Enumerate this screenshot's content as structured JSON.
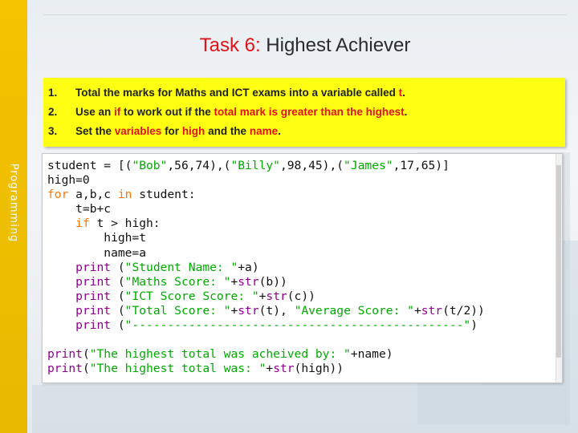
{
  "side_label": "Programming",
  "title": {
    "accent": "Task 6:",
    "rest": "Highest Achiever"
  },
  "tasks": [
    {
      "num": "1.",
      "parts": [
        {
          "text": "Total the marks for Maths and ICT exams into a variable called ",
          "color": "dark"
        },
        {
          "text": "t",
          "color": "red"
        },
        {
          "text": ".",
          "color": "dark"
        }
      ]
    },
    {
      "num": "2.",
      "parts": [
        {
          "text": "Use an ",
          "color": "dark"
        },
        {
          "text": "if",
          "color": "red"
        },
        {
          "text": " to work out if the ",
          "color": "dark"
        },
        {
          "text": "total mark is greater than the highest",
          "color": "red"
        },
        {
          "text": ".",
          "color": "dark"
        }
      ]
    },
    {
      "num": "3.",
      "parts": [
        {
          "text": "Set the ",
          "color": "dark"
        },
        {
          "text": "variables",
          "color": "red"
        },
        {
          "text": " for ",
          "color": "dark"
        },
        {
          "text": "high",
          "color": "red"
        },
        {
          "text": " and the ",
          "color": "dark"
        },
        {
          "text": "name",
          "color": "red"
        },
        {
          "text": ".",
          "color": "dark"
        }
      ]
    }
  ],
  "code": {
    "lines": [
      [
        [
          "student = [(",
          "n"
        ],
        [
          "\"Bob\"",
          "s"
        ],
        [
          ",56,74),(",
          "n"
        ],
        [
          "\"Billy\"",
          "s"
        ],
        [
          ",98,45),(",
          "n"
        ],
        [
          "\"James\"",
          "s"
        ],
        [
          ",17,65)]",
          "n"
        ]
      ],
      [
        [
          "high=0",
          "n"
        ]
      ],
      [
        [
          "for",
          "k"
        ],
        [
          " a,b,c ",
          "n"
        ],
        [
          "in",
          "k"
        ],
        [
          " student:",
          "n"
        ]
      ],
      [
        [
          "    t=b+c",
          "n"
        ]
      ],
      [
        [
          "    ",
          "n"
        ],
        [
          "if",
          "k"
        ],
        [
          " t > high:",
          "n"
        ]
      ],
      [
        [
          "        high=t",
          "n"
        ]
      ],
      [
        [
          "        name=a",
          "n"
        ]
      ],
      [
        [
          "    ",
          "n"
        ],
        [
          "print",
          "b"
        ],
        [
          " (",
          "n"
        ],
        [
          "\"Student Name: \"",
          "s"
        ],
        [
          "+a)",
          "n"
        ]
      ],
      [
        [
          "    ",
          "n"
        ],
        [
          "print",
          "b"
        ],
        [
          " (",
          "n"
        ],
        [
          "\"Maths Score: \"",
          "s"
        ],
        [
          "+",
          "n"
        ],
        [
          "str",
          "b"
        ],
        [
          "(b))",
          "n"
        ]
      ],
      [
        [
          "    ",
          "n"
        ],
        [
          "print",
          "b"
        ],
        [
          " (",
          "n"
        ],
        [
          "\"ICT Score Score: \"",
          "s"
        ],
        [
          "+",
          "n"
        ],
        [
          "str",
          "b"
        ],
        [
          "(c))",
          "n"
        ]
      ],
      [
        [
          "    ",
          "n"
        ],
        [
          "print",
          "b"
        ],
        [
          " (",
          "n"
        ],
        [
          "\"Total Score: \"",
          "s"
        ],
        [
          "+",
          "n"
        ],
        [
          "str",
          "b"
        ],
        [
          "(t), ",
          "n"
        ],
        [
          "\"Average Score: \"",
          "s"
        ],
        [
          "+",
          "n"
        ],
        [
          "str",
          "b"
        ],
        [
          "(t/2))",
          "n"
        ]
      ],
      [
        [
          "    ",
          "n"
        ],
        [
          "print",
          "b"
        ],
        [
          " (",
          "n"
        ],
        [
          "\"-----------------------------------------------\"",
          "s"
        ],
        [
          ")",
          "n"
        ]
      ],
      [],
      [
        [
          "print",
          "b"
        ],
        [
          "(",
          "n"
        ],
        [
          "\"The highest total was acheived by: \"",
          "s"
        ],
        [
          "+name)",
          "n"
        ]
      ],
      [
        [
          "print",
          "b"
        ],
        [
          "(",
          "n"
        ],
        [
          "\"The highest total was: \"",
          "s"
        ],
        [
          "+",
          "n"
        ],
        [
          "str",
          "b"
        ],
        [
          "(high))",
          "n"
        ]
      ]
    ]
  }
}
